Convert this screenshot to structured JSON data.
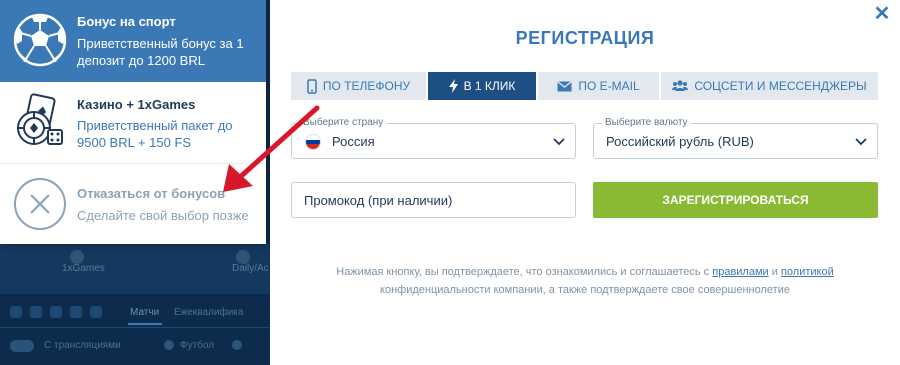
{
  "colors": {
    "accent": "#3a79b6",
    "dark_tab": "#1d4f84",
    "register_green": "#8ab934",
    "annotation_arrow": "#d7182a"
  },
  "background_site": {
    "band_left": "1xGames",
    "band_right": "Daily/Ac",
    "tab_matches": "Матчи",
    "tab_upcoming": "Ежеквалифика",
    "row_label_live": "С трансляциями",
    "row_label_football": "Футбол"
  },
  "bonus_panel": {
    "sport": {
      "icon": "soccer-ball-icon",
      "title": "Бонус на спорт",
      "description": "Приветственный бонус за 1 депозит до 1200 BRL"
    },
    "casino": {
      "icon": "casino-chips-icon",
      "title": "Казино + 1xGames",
      "description": "Приветственный пакет до 9500 BRL + 150 FS"
    },
    "decline": {
      "icon": "close-circle-icon",
      "title": "Отказаться от бонусов",
      "description": "Сделайте свой выбор позже"
    }
  },
  "modal": {
    "title": "РЕГИСТРАЦИЯ",
    "close_icon": "close-icon",
    "tabs": [
      {
        "icon": "phone-icon",
        "label": "ПО ТЕЛЕФОНУ"
      },
      {
        "icon": "lightning-icon",
        "label": "В 1 КЛИК",
        "active": true
      },
      {
        "icon": "envelope-icon",
        "label": "ПО E-MAIL"
      },
      {
        "icon": "people-icon",
        "label": "СОЦСЕТИ И МЕССЕНДЖЕРЫ"
      }
    ],
    "country": {
      "label": "Выберите страну",
      "value": "Россия",
      "flag_colors": [
        "#ffffff",
        "#0039a6",
        "#d52b1e"
      ]
    },
    "currency": {
      "label": "Выберите валюту",
      "value": "Российский рубль (RUB)"
    },
    "promo": {
      "placeholder": "Промокод (при наличии)",
      "value": ""
    },
    "register_button": "ЗАРЕГИСТРИРОВАТЬСЯ",
    "disclaimer": {
      "before_rules": "Нажимая кнопку, вы подтверждаете, что ознакомились и соглашаетесь с ",
      "rules_link": "правилами",
      "and": " и ",
      "policy_link": "политикой",
      "after_policy": " конфиденциальности компании, а также подтверждаете свое совершеннолетие"
    }
  }
}
